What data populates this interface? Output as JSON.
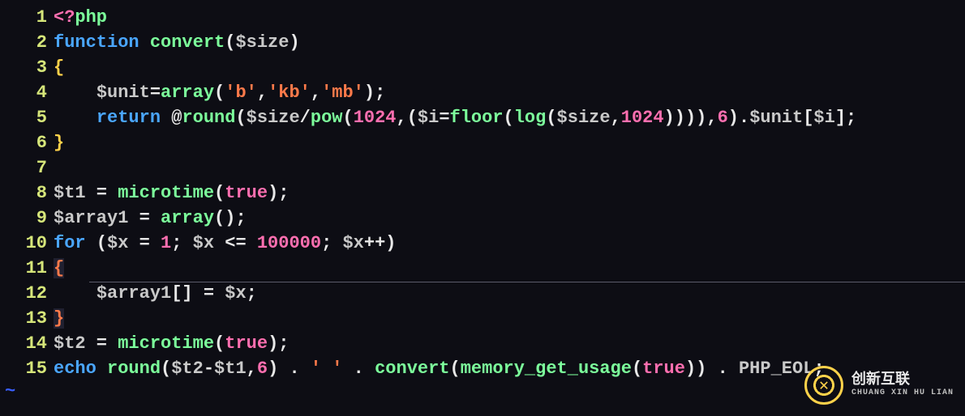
{
  "watermark": {
    "brand_cn": "创新互联",
    "brand_en": "CHUANG XIN HU LIAN"
  },
  "code": {
    "language": "php",
    "lines": [
      {
        "num": "1",
        "tokens": [
          {
            "t": "<?",
            "c": "tag"
          },
          {
            "t": "php",
            "c": "fn"
          }
        ]
      },
      {
        "num": "2",
        "tokens": [
          {
            "t": "function",
            "c": "kw"
          },
          {
            "t": " ",
            "c": "punc"
          },
          {
            "t": "convert",
            "c": "fn"
          },
          {
            "t": "(",
            "c": "paren"
          },
          {
            "t": "$size",
            "c": "var"
          },
          {
            "t": ")",
            "c": "paren"
          }
        ]
      },
      {
        "num": "3",
        "tokens": [
          {
            "t": "{",
            "c": "brace"
          }
        ]
      },
      {
        "num": "4",
        "tokens": [
          {
            "t": "    ",
            "c": "punc"
          },
          {
            "t": "$unit",
            "c": "var"
          },
          {
            "t": "=",
            "c": "op"
          },
          {
            "t": "array",
            "c": "fn"
          },
          {
            "t": "(",
            "c": "paren"
          },
          {
            "t": "'b'",
            "c": "str"
          },
          {
            "t": ",",
            "c": "punc"
          },
          {
            "t": "'kb'",
            "c": "str"
          },
          {
            "t": ",",
            "c": "punc"
          },
          {
            "t": "'mb'",
            "c": "str"
          },
          {
            "t": ");",
            "c": "punc"
          }
        ]
      },
      {
        "num": "5",
        "tokens": [
          {
            "t": "    ",
            "c": "punc"
          },
          {
            "t": "return",
            "c": "kw"
          },
          {
            "t": " @",
            "c": "punc"
          },
          {
            "t": "round",
            "c": "fn"
          },
          {
            "t": "(",
            "c": "paren"
          },
          {
            "t": "$size",
            "c": "var"
          },
          {
            "t": "/",
            "c": "op"
          },
          {
            "t": "pow",
            "c": "fn"
          },
          {
            "t": "(",
            "c": "paren"
          },
          {
            "t": "1024",
            "c": "num"
          },
          {
            "t": ",(",
            "c": "punc"
          },
          {
            "t": "$i",
            "c": "var"
          },
          {
            "t": "=",
            "c": "op"
          },
          {
            "t": "floor",
            "c": "fn"
          },
          {
            "t": "(",
            "c": "paren"
          },
          {
            "t": "log",
            "c": "fn"
          },
          {
            "t": "(",
            "c": "paren"
          },
          {
            "t": "$size",
            "c": "var"
          },
          {
            "t": ",",
            "c": "punc"
          },
          {
            "t": "1024",
            "c": "num"
          },
          {
            "t": ")))),",
            "c": "punc"
          },
          {
            "t": "6",
            "c": "num"
          },
          {
            "t": ").",
            "c": "punc"
          },
          {
            "t": "$unit",
            "c": "var"
          },
          {
            "t": "[",
            "c": "punc"
          },
          {
            "t": "$i",
            "c": "var"
          },
          {
            "t": "];",
            "c": "punc"
          }
        ]
      },
      {
        "num": "6",
        "tokens": [
          {
            "t": "}",
            "c": "brace"
          }
        ]
      },
      {
        "num": "7",
        "tokens": []
      },
      {
        "num": "8",
        "tokens": [
          {
            "t": "$t1",
            "c": "var"
          },
          {
            "t": " = ",
            "c": "op"
          },
          {
            "t": "microtime",
            "c": "fn"
          },
          {
            "t": "(",
            "c": "paren"
          },
          {
            "t": "true",
            "c": "true"
          },
          {
            "t": ");",
            "c": "punc"
          }
        ]
      },
      {
        "num": "9",
        "tokens": [
          {
            "t": "$array1",
            "c": "var"
          },
          {
            "t": " = ",
            "c": "op"
          },
          {
            "t": "array",
            "c": "fn"
          },
          {
            "t": "();",
            "c": "punc"
          }
        ]
      },
      {
        "num": "10",
        "tokens": [
          {
            "t": "for",
            "c": "kw"
          },
          {
            "t": " (",
            "c": "punc"
          },
          {
            "t": "$x",
            "c": "var"
          },
          {
            "t": " = ",
            "c": "op"
          },
          {
            "t": "1",
            "c": "num"
          },
          {
            "t": "; ",
            "c": "punc"
          },
          {
            "t": "$x",
            "c": "var"
          },
          {
            "t": " <= ",
            "c": "op"
          },
          {
            "t": "100000",
            "c": "num"
          },
          {
            "t": "; ",
            "c": "punc"
          },
          {
            "t": "$x",
            "c": "var"
          },
          {
            "t": "++)",
            "c": "punc"
          }
        ]
      },
      {
        "num": "11",
        "tokens": [
          {
            "t": "{",
            "c": "brace-hl"
          }
        ]
      },
      {
        "num": "12",
        "tokens": [
          {
            "t": "    ",
            "c": "punc"
          },
          {
            "t": "$array1",
            "c": "var"
          },
          {
            "t": "[] = ",
            "c": "op"
          },
          {
            "t": "$x",
            "c": "var"
          },
          {
            "t": ";",
            "c": "punc"
          }
        ]
      },
      {
        "num": "13",
        "tokens": [
          {
            "t": "}",
            "c": "brace-hl"
          }
        ]
      },
      {
        "num": "14",
        "tokens": [
          {
            "t": "$t2",
            "c": "var"
          },
          {
            "t": " = ",
            "c": "op"
          },
          {
            "t": "microtime",
            "c": "fn"
          },
          {
            "t": "(",
            "c": "paren"
          },
          {
            "t": "true",
            "c": "true"
          },
          {
            "t": ");",
            "c": "punc"
          }
        ]
      },
      {
        "num": "15",
        "tokens": [
          {
            "t": "echo",
            "c": "kw"
          },
          {
            "t": " ",
            "c": "punc"
          },
          {
            "t": "round",
            "c": "fn"
          },
          {
            "t": "(",
            "c": "paren"
          },
          {
            "t": "$t2",
            "c": "var"
          },
          {
            "t": "-",
            "c": "op"
          },
          {
            "t": "$t1",
            "c": "var"
          },
          {
            "t": ",",
            "c": "punc"
          },
          {
            "t": "6",
            "c": "num"
          },
          {
            "t": ") . ",
            "c": "punc"
          },
          {
            "t": "' '",
            "c": "str"
          },
          {
            "t": " . ",
            "c": "punc"
          },
          {
            "t": "convert",
            "c": "fn"
          },
          {
            "t": "(",
            "c": "paren"
          },
          {
            "t": "memory_get_usage",
            "c": "fn"
          },
          {
            "t": "(",
            "c": "paren"
          },
          {
            "t": "true",
            "c": "true"
          },
          {
            "t": ")) . ",
            "c": "punc"
          },
          {
            "t": "PHP_EOL",
            "c": "const"
          },
          {
            "t": ";",
            "c": "punc"
          }
        ]
      }
    ]
  }
}
